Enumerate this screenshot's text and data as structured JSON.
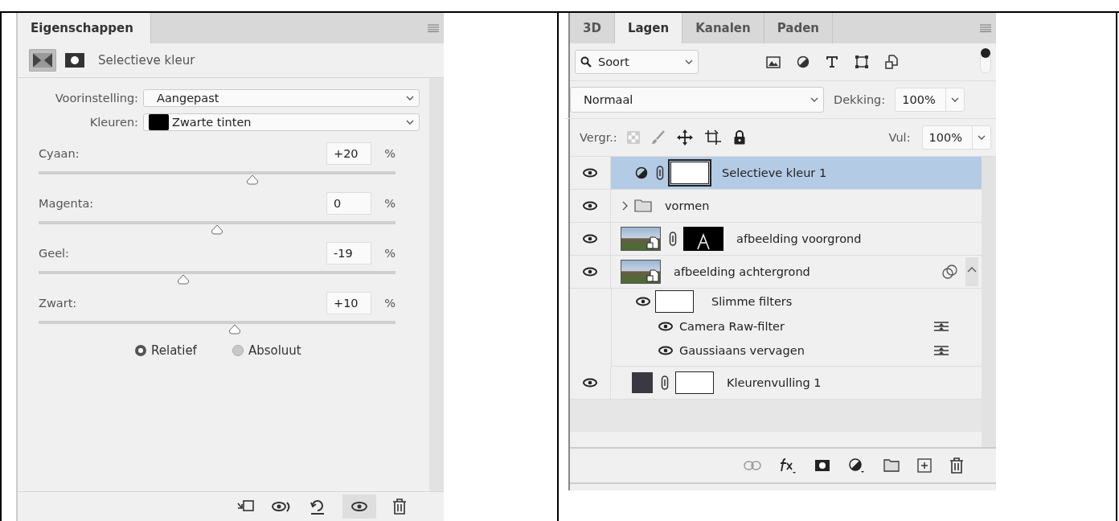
{
  "properties_panel": {
    "tabs": [
      {
        "label": "Eigenschappen",
        "selected": true
      }
    ],
    "view_toggle": [
      {
        "kind": "adjustment",
        "selected": true
      },
      {
        "kind": "mask",
        "selected": false
      }
    ],
    "title": "Selectieve kleur",
    "preset": {
      "label": "Voorinstelling:",
      "value": "Aangepast"
    },
    "colors": {
      "label": "Kleuren:",
      "value": "Zwarte tinten",
      "color": "#000000"
    },
    "sliders": [
      {
        "label": "Cyaan:",
        "value": "+20",
        "unit": "%",
        "level": 0.6
      },
      {
        "label": "Magenta:",
        "value": "0",
        "unit": "%",
        "level": 0.5
      },
      {
        "label": "Geel:",
        "value": "-19",
        "unit": "%",
        "level": 0.405
      },
      {
        "label": "Zwart:",
        "value": "+10",
        "unit": "%",
        "level": 0.55
      }
    ],
    "method": [
      {
        "label": "Relatief",
        "selected": true
      },
      {
        "label": "Absoluut",
        "selected": false
      }
    ],
    "footer": {
      "visibility_pressed": true
    }
  },
  "layers_panel": {
    "tabs": [
      {
        "label": "3D",
        "selected": false
      },
      {
        "label": "Lagen",
        "selected": true
      },
      {
        "label": "Kanalen",
        "selected": false
      },
      {
        "label": "Paden",
        "selected": false
      }
    ],
    "filter": {
      "value": "Soort"
    },
    "blend_mode": {
      "value": "Normaal"
    },
    "opacity": {
      "label": "Dekking:",
      "value": "100%"
    },
    "lock": {
      "label": "Vergr.:"
    },
    "fill": {
      "label": "Vul:",
      "value": "100%"
    },
    "layers": [
      {
        "kind": "adjustment",
        "name": "Selectieve kleur 1",
        "selected": true
      },
      {
        "kind": "group",
        "name": "vormen",
        "selected": false,
        "expanded": false
      },
      {
        "kind": "masked_image",
        "name": "afbeelding voorgrond",
        "selected": false
      },
      {
        "kind": "smart_object",
        "name": "afbeelding achtergrond",
        "selected": false,
        "expanded": true,
        "smart_filters": {
          "label": "Slimme filters",
          "filters": [
            {
              "name": "Camera Raw-filter"
            },
            {
              "name": "Gaussiaans vervagen"
            }
          ]
        }
      },
      {
        "kind": "fill",
        "name": "Kleurenvulling 1",
        "selected": false,
        "color": "#3a3840"
      }
    ]
  }
}
